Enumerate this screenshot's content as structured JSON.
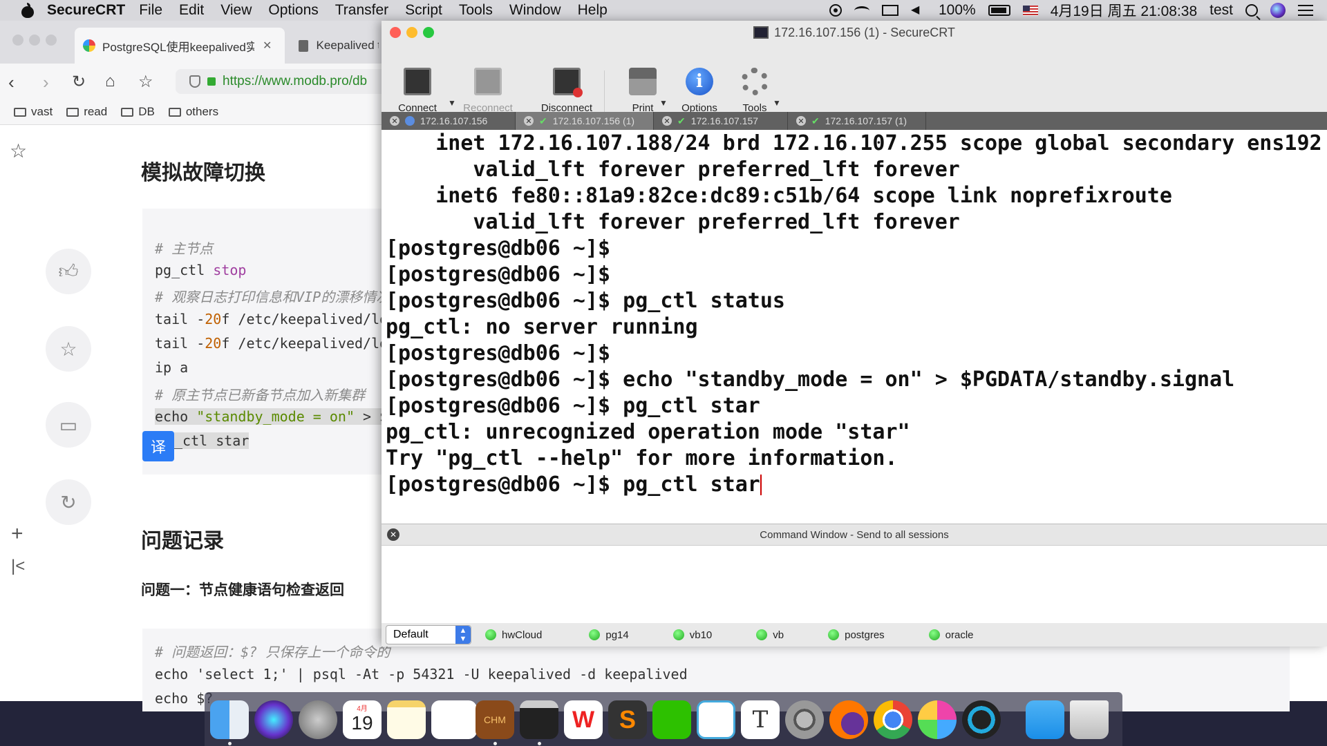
{
  "menubar": {
    "app_name": "SecureCRT",
    "items": [
      "File",
      "Edit",
      "View",
      "Options",
      "Transfer",
      "Script",
      "Tools",
      "Window",
      "Help"
    ],
    "battery": "100%",
    "datetime": "4月19日 周五 21:08:38",
    "user": "test"
  },
  "browser": {
    "tabs": [
      {
        "title": "PostgreSQL使用keepalived实",
        "active": true
      },
      {
        "title": "Keepalived t",
        "active": false
      }
    ],
    "url": "https://www.modb.pro/db",
    "bookmarks": [
      "vast",
      "read",
      "DB",
      "others"
    ],
    "article": {
      "heading1": "模拟故障切换",
      "code1": [
        {
          "type": "comment",
          "text": "# 主节点"
        },
        {
          "type": "cmd",
          "text": "pg_ctl ",
          "kw": "stop"
        },
        {
          "type": "comment",
          "text": "# 观察日志打印信息和VIP的漂移情况"
        },
        {
          "type": "tail",
          "pre": "tail -",
          "num": "20",
          "post": "f /etc/keepalived/lo"
        },
        {
          "type": "tail",
          "pre": "tail -",
          "num": "20",
          "post": "f /etc/keepalived/lo"
        },
        {
          "type": "plain",
          "text": "ip a"
        },
        {
          "type": "comment",
          "text": "# 原主节点已新备节点加入新集群"
        },
        {
          "type": "echo",
          "pre": "echo ",
          "str": "\"standby_mode = on\"",
          "post": " > $"
        },
        {
          "type": "plain",
          "text": "_ctl star"
        }
      ],
      "translate_badge": "译",
      "heading2": "问题记录",
      "paragraph": "问题一：节点健康语句检查返回",
      "code2": [
        {
          "type": "comment",
          "text": "# 问题返回：$? 只保存上一个命令的"
        },
        {
          "type": "plain",
          "text": "echo 'select 1;' | psql -At -p 54321 -U keepalived -d keepalived"
        },
        {
          "type": "plain",
          "text": "echo $?"
        }
      ]
    }
  },
  "crt": {
    "title": "172.16.107.156 (1) - SecureCRT",
    "toolbar": [
      {
        "label": "Connect",
        "enabled": true
      },
      {
        "label": "Reconnect",
        "enabled": false
      },
      {
        "label": "Disconnect",
        "enabled": true
      },
      {
        "label": "Print",
        "enabled": true
      },
      {
        "label": "Options",
        "enabled": true
      },
      {
        "label": "Tools",
        "enabled": true
      }
    ],
    "tabs": [
      {
        "label": "172.16.107.156",
        "status": "info",
        "active": false
      },
      {
        "label": "172.16.107.156 (1)",
        "status": "ok",
        "active": true
      },
      {
        "label": "172.16.107.157",
        "status": "ok",
        "active": false
      },
      {
        "label": "172.16.107.157 (1)",
        "status": "ok",
        "active": false
      }
    ],
    "terminal_lines": [
      "    inet 172.16.107.188/24 brd 172.16.107.255 scope global secondary ens192",
      "       valid_lft forever preferred_lft forever",
      "    inet6 fe80::81a9:82ce:dc89:c51b/64 scope link noprefixroute",
      "       valid_lft forever preferred_lft forever",
      "[postgres@db06 ~]$",
      "[postgres@db06 ~]$",
      "[postgres@db06 ~]$ pg_ctl status",
      "pg_ctl: no server running",
      "[postgres@db06 ~]$",
      "[postgres@db06 ~]$ echo \"standby_mode = on\" > $PGDATA/standby.signal",
      "[postgres@db06 ~]$ pg_ctl star",
      "pg_ctl: unrecognized operation mode \"star\"",
      "Try \"pg_ctl --help\" for more information.",
      "[postgres@db06 ~]$ pg_ctl star"
    ],
    "command_window_title": "Command Window - Send to all sessions",
    "button_bar_select": "Default",
    "sessions": [
      "hwCloud",
      "pg14",
      "vb10",
      "vb",
      "postgres",
      "oracle"
    ]
  },
  "dock": {
    "icons": [
      "finder-icon",
      "siri-icon",
      "launchpad-icon",
      "calendar-icon",
      "notes-icon",
      "reminders-icon",
      "chm-reader-icon",
      "securecrt-icon",
      "wps-icon",
      "sublime-icon",
      "wechat-icon",
      "messages-icon",
      "typora-icon",
      "system-preferences-icon",
      "firefox-icon",
      "chrome-icon",
      "chrome-canary-icon",
      "quicktime-icon",
      "folder-icon",
      "trash-icon"
    ],
    "calendar_day": "19",
    "calendar_month": "4月",
    "chm_label": "CHM",
    "typora_label": "T"
  }
}
